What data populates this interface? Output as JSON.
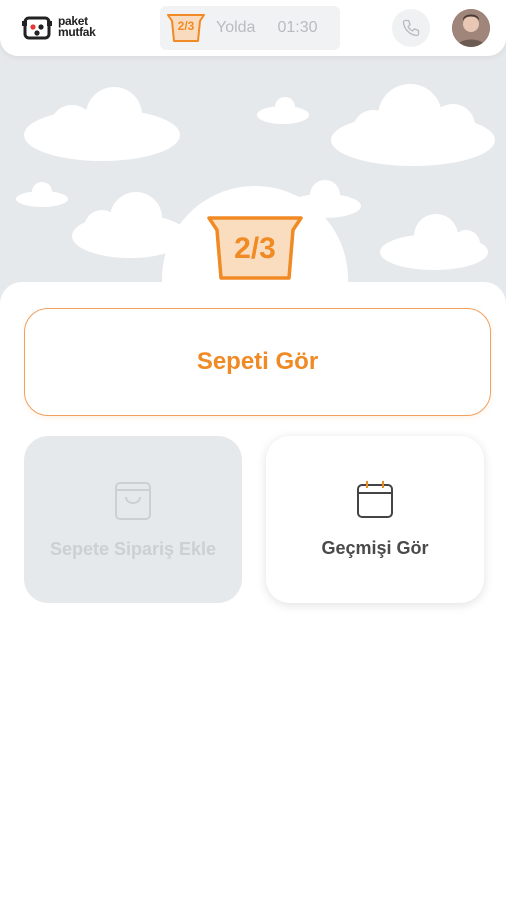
{
  "brand": {
    "logo_line1": "paket",
    "logo_line2": "mutfak"
  },
  "status": {
    "basket_count": "2/3",
    "state": "Yolda",
    "time": "01:30"
  },
  "icons": {
    "call": "phone-icon",
    "avatar": "user-avatar",
    "basket": "basket-icon",
    "bag": "shopping-bag-icon",
    "calendar": "calendar-icon"
  },
  "hero": {
    "basket_count": "2/3"
  },
  "actions": {
    "view_cart": "Sepeti Gör",
    "add_order": "Sepete Sipariş Ekle",
    "view_history": "Geçmişi Gör"
  },
  "colors": {
    "accent": "#f08a24",
    "sky": "#e6e9ec",
    "disabled_text": "#cbd0d4"
  }
}
